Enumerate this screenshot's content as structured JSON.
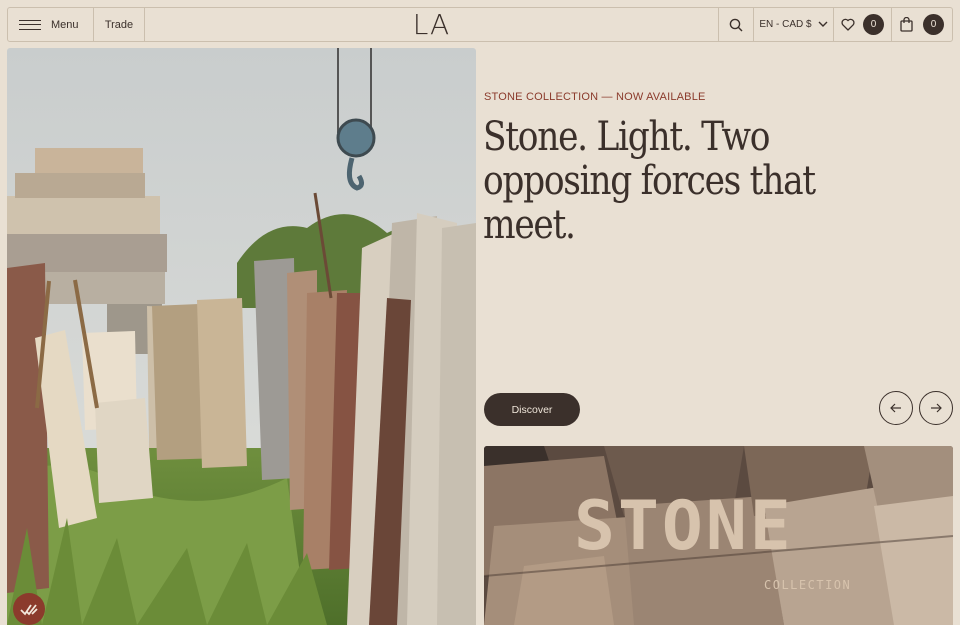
{
  "header": {
    "menu_label": "Menu",
    "trade_label": "Trade",
    "logo": "LA",
    "locale": "EN - CAD $",
    "wishlist_count": "0",
    "cart_count": "0",
    "icons": [
      "hamburger-icon",
      "search-icon",
      "chevron-down-icon",
      "heart-icon",
      "shopping-bag-icon"
    ]
  },
  "hero": {
    "eyebrow": "STONE COLLECTION — NOW AVAILABLE",
    "headline": "Stone. Light. Two opposing forces that meet.",
    "cta_label": "Discover",
    "prev_icon": "arrow-left-icon",
    "next_icon": "arrow-right-icon"
  },
  "feature": {
    "title": "STONE",
    "subtitle": "COLLECTION"
  },
  "colors": {
    "background": "#e9e0d3",
    "text": "#3b302b",
    "accent": "#8b3b2c",
    "border": "#cbbfae"
  }
}
